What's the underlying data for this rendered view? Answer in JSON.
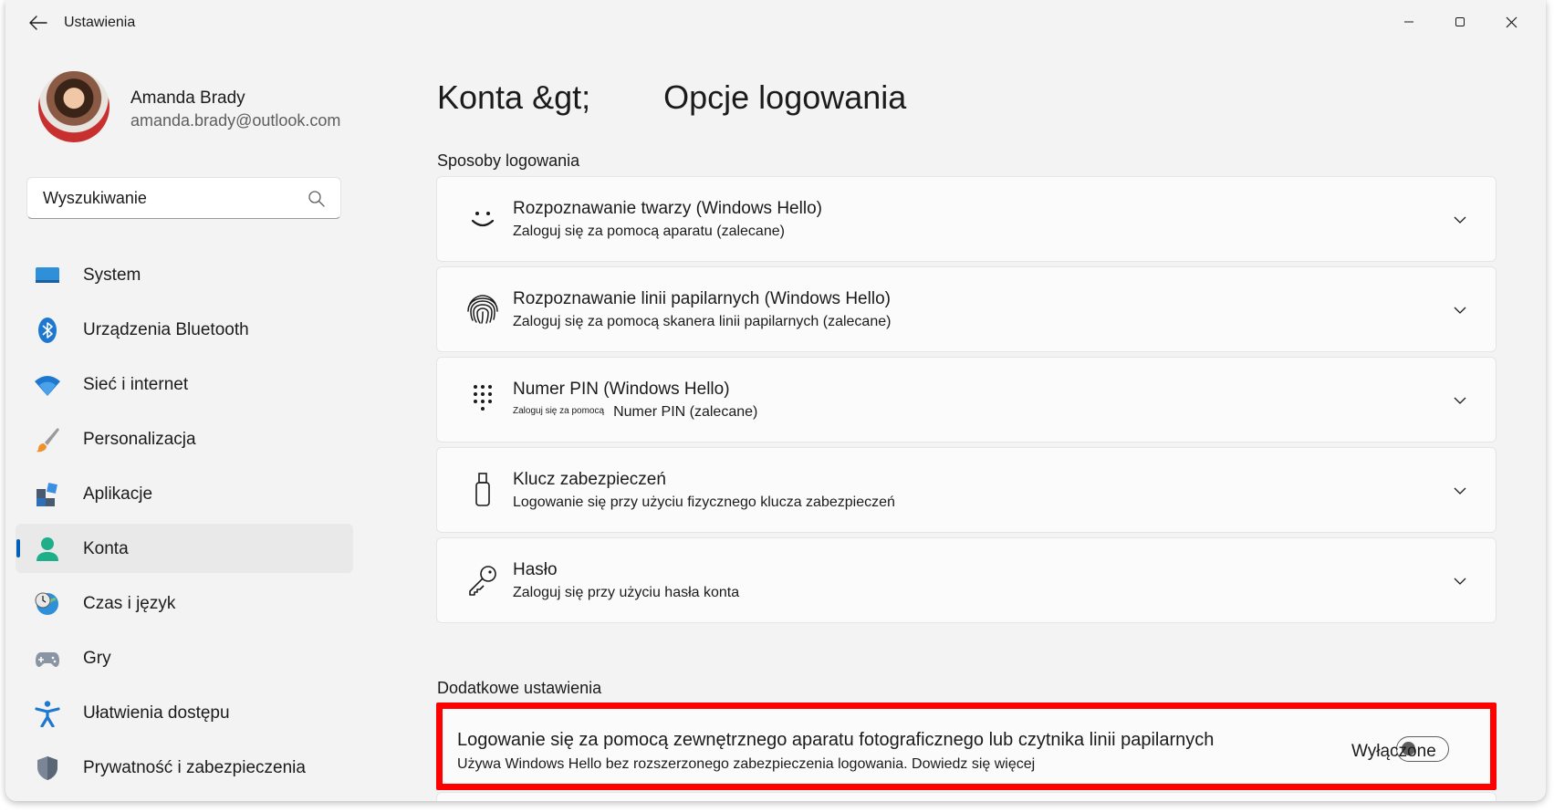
{
  "window": {
    "title": "Ustawienia"
  },
  "profile": {
    "name": "Amanda Brady",
    "email": "amanda.brady@outlook.com"
  },
  "search": {
    "placeholder": "Wyszukiwanie"
  },
  "nav": {
    "items": [
      {
        "label": "System",
        "icon": "monitor-icon"
      },
      {
        "label": "Urządzenia Bluetooth",
        "icon": "bluetooth-icon"
      },
      {
        "label": "Sieć i internet",
        "icon": "wifi-icon"
      },
      {
        "label": "Personalizacja",
        "icon": "brush-icon"
      },
      {
        "label": "Aplikacje",
        "icon": "apps-icon"
      },
      {
        "label": "Konta",
        "icon": "account-icon",
        "selected": true
      },
      {
        "label": "Czas i język",
        "icon": "time-language-icon"
      },
      {
        "label": "Gry",
        "icon": "gamepad-icon"
      },
      {
        "label": "Ułatwienia dostępu",
        "icon": "accessibility-icon"
      },
      {
        "label": "Prywatność i zabezpieczenia",
        "icon": "shield-icon"
      }
    ]
  },
  "header": {
    "breadcrumb_parent": "Konta &gt;",
    "breadcrumb_current": "Opcje logowania"
  },
  "sign_in_section": {
    "title": "Sposoby logowania",
    "options": [
      {
        "title": "Rozpoznawanie twarzy (Windows Hello)",
        "subtitle": "Zaloguj się za pomocą aparatu (zalecane)",
        "icon": "face-icon"
      },
      {
        "title": "Rozpoznawanie linii papilarnych (Windows Hello)",
        "subtitle": "Zaloguj się za pomocą skanera linii papilarnych (zalecane)",
        "icon": "fingerprint-icon"
      },
      {
        "title": "Numer PIN (Windows Hello)",
        "subtitle_small": "Zaloguj się za pomocą",
        "subtitle": "Numer PIN (zalecane)",
        "icon": "pin-keypad-icon"
      },
      {
        "title": "Klucz zabezpieczeń",
        "subtitle": "Logowanie się przy użyciu fizycznego klucza zabezpieczeń",
        "icon": "usb-key-icon"
      },
      {
        "title": "Hasło",
        "subtitle": "Zaloguj się przy użyciu hasła konta",
        "icon": "password-key-icon"
      }
    ]
  },
  "additional_section": {
    "title": "Dodatkowe ustawienia",
    "external_camera": {
      "title": "Logowanie się za pomocą zewnętrznego aparatu fotograficznego lub czytnika linii papilarnych",
      "subtitle": "Używa Windows Hello bez rozszerzonego zabezpieczenia logowania.",
      "link": "Dowiedz się więcej",
      "toggle_label": "Wyłączone",
      "toggle_on": false
    }
  },
  "colors": {
    "accent": "#005fb8",
    "highlight_border": "#ff0000",
    "window_bg": "#f3f3f3",
    "card_bg": "#fbfbfb"
  }
}
